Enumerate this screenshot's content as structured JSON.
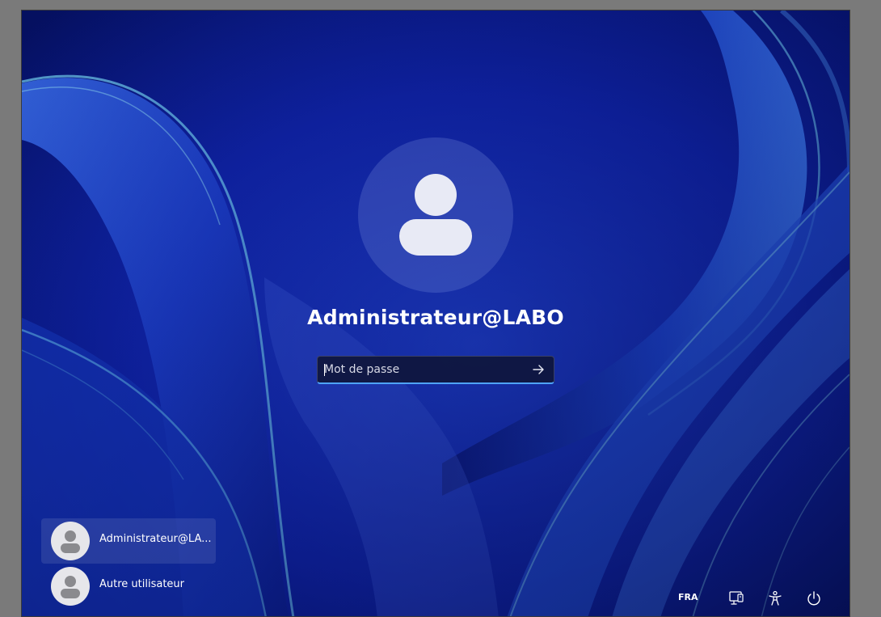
{
  "lock_screen": {
    "username": "Administrateur@LABO",
    "password_placeholder": "Mot de passe"
  },
  "user_list": {
    "items": [
      {
        "label": "Administrateur@LA...",
        "selected": true
      },
      {
        "label": "Autre utilisateur",
        "selected": false
      }
    ]
  },
  "tray": {
    "language": "FRA",
    "icons": [
      "network-icon",
      "accessibility-icon",
      "power-icon"
    ]
  },
  "colors": {
    "wallpaper_base": "#0a1a8a",
    "accent": "#4ea3ff",
    "text": "#ffffff"
  }
}
